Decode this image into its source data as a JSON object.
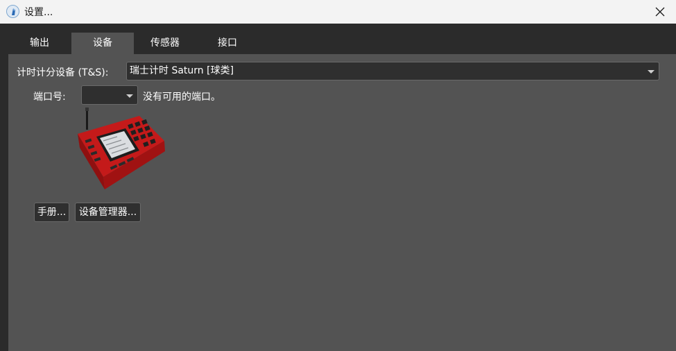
{
  "window": {
    "title": "设置...",
    "icon": "app-icon",
    "close_icon": "close-icon"
  },
  "tabs": [
    {
      "label": "输出",
      "active": false
    },
    {
      "label": "设备",
      "active": true
    },
    {
      "label": "传感器",
      "active": false
    },
    {
      "label": "接口",
      "active": false
    }
  ],
  "device": {
    "label": "计时计分设备 (T&S):",
    "selected": "瑞士计时 Saturn [球类]",
    "image_icon": "timing-console-device"
  },
  "port": {
    "label": "端口号:",
    "selected": "",
    "status": "没有可用的端口。"
  },
  "buttons": {
    "manual": "手册...",
    "device_manager": "设备管理器..."
  }
}
